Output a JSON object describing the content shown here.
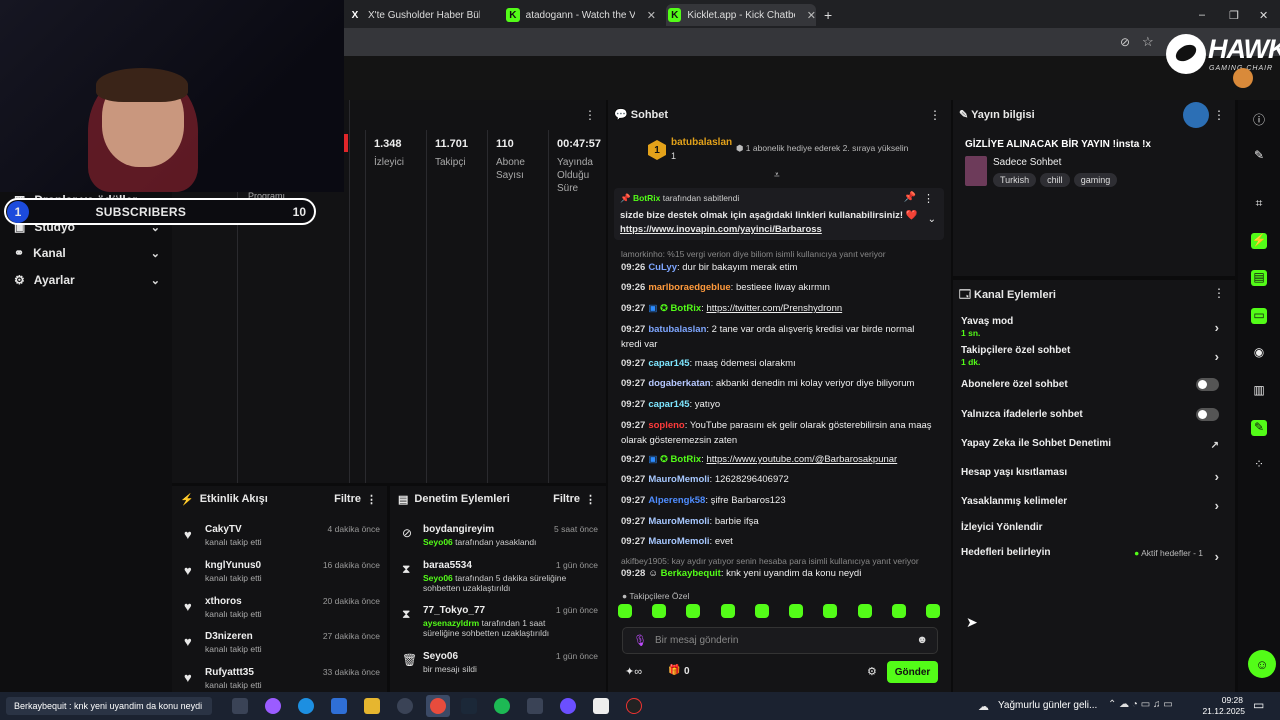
{
  "browser": {
    "tabs": [
      {
        "icon": "X",
        "label": "X'te Gusholder Haber Bülteni: \""
      },
      {
        "icon": "K",
        "label": "atadogann - Watch the VOD on"
      },
      {
        "icon": "K",
        "label": "Kicklet.app - Kick Chatbot and C"
      }
    ],
    "new_tab": "+",
    "window_controls": [
      "–",
      "❐",
      "✕"
    ]
  },
  "overlay": {
    "logo_text": "HAWK",
    "logo_sub": "GAMING CHAIR",
    "subs_current": "1",
    "subs_label": "SUBSCRIBERS",
    "subs_goal": "10"
  },
  "sidebar": {
    "items": [
      {
        "icon": "drops-icon",
        "label": "Droplar ve ödüller"
      },
      {
        "icon": "studio-icon",
        "label": "Stüdyo"
      },
      {
        "icon": "channel-icon",
        "label": "Kanal"
      },
      {
        "icon": "settings-icon",
        "label": "Ayarlar"
      }
    ]
  },
  "stats": {
    "program_label": "Programı",
    "items": [
      {
        "value": "1.348",
        "label": "İzleyici"
      },
      {
        "value": "11.701",
        "label": "Takipçi"
      },
      {
        "value": "110",
        "label": "Abone Sayısı"
      },
      {
        "value": "00:47:57",
        "label": "Yayında Olduğu Süre"
      }
    ]
  },
  "activity_feed": {
    "title": "Etkinlik Akışı",
    "filter": "Filtre",
    "items": [
      {
        "name": "CakyTV",
        "sub": "kanalı takip etti",
        "time": "4 dakika önce"
      },
      {
        "name": "knglYunus0",
        "sub": "kanalı takip etti",
        "time": "16 dakika önce"
      },
      {
        "name": "xthoros",
        "sub": "kanalı takip etti",
        "time": "20 dakika önce"
      },
      {
        "name": "D3nizeren",
        "sub": "kanalı takip etti",
        "time": "27 dakika önce"
      },
      {
        "name": "Rufyattt35",
        "sub": "kanalı takip etti",
        "time": "33 dakika önce"
      }
    ]
  },
  "moderation": {
    "title": "Denetim Eylemleri",
    "filter": "Filtre",
    "items": [
      {
        "icon": "ban-icon",
        "name": "boydangireyim",
        "actor": "Seyo06",
        "sub": " tarafından yasaklandı",
        "time": "5 saat önce"
      },
      {
        "icon": "hourglass-icon",
        "name": "baraa5534",
        "actor": "Seyo06",
        "sub": " tarafından 5 dakika süreliğine sohbetten uzaklaştırıldı",
        "time": "1 gün önce"
      },
      {
        "icon": "hourglass-icon",
        "name": "77_Tokyo_77",
        "actor": "aysenazyldrm",
        "sub": " tarafından 1 saat süreliğine sohbetten uzaklaştırıldı",
        "time": "1 gün önce"
      },
      {
        "icon": "trash-icon",
        "name": "Seyo06",
        "actor": "",
        "sub": "bir mesajı sildi",
        "time": "1 gün önce"
      }
    ]
  },
  "chat": {
    "title": "Sohbet",
    "gifter_name": "batubalaslan",
    "gifter_rank": "1",
    "gifter_count": "1",
    "gift_text": "1 abonelik hediye ederek 2. sıraya yükselin",
    "pinned_by": "BotRix",
    "pinned_suffix": " tarafından sabitlendi",
    "pinned_text": "sizde bize destek olmak için aşağıdaki linkleri kullanabilirsiniz! ❤️",
    "pinned_link": "https://www.inovapin.com/yayinci/Barbaross",
    "reply1": "lamorkinho: %15 vergi verion diye biliom isimli kullanıcıya yanıt veriyor",
    "messages": [
      {
        "time": "09:26",
        "user": "CuLyy",
        "color": "#7ea6ff",
        "text": ": dur bir bakayım merak etim"
      },
      {
        "time": "09:26",
        "user": "marlboraedgeblue",
        "color": "#ff9a3c",
        "text": ": bestieee liway akırmın"
      },
      {
        "time": "09:27",
        "user": "BotRix",
        "color": "#53fc18",
        "text": ": ",
        "link": "https://twitter.com/Prenshydronn"
      },
      {
        "time": "09:27",
        "user": "batubalaslan",
        "color": "#7ea6ff",
        "text": ": 2 tane var orda alışveriş kredisi var birde normal kredi var"
      },
      {
        "time": "09:27",
        "user": "capar145",
        "color": "#7ee6ff",
        "text": ": maaş ödemesi olarakmı"
      },
      {
        "time": "09:27",
        "user": "dogaberkatan",
        "color": "#b6c8ff",
        "text": ": akbanki denedin mi kolay veriyor diye biliyorum"
      },
      {
        "time": "09:27",
        "user": "capar145",
        "color": "#7ee6ff",
        "text": ": yatıyo"
      },
      {
        "time": "09:27",
        "user": "sopleno",
        "color": "#ff3b3b",
        "text": ": YouTube parasını ek gelir olarak gösterebilirsin ana maaş olarak gösteremezsin zaten"
      },
      {
        "time": "09:27",
        "user": "BotRix",
        "color": "#53fc18",
        "text": ": ",
        "link": "https://www.youtube.com/@Barbarosakpunar"
      },
      {
        "time": "09:27",
        "user": "MauroMemoli",
        "color": "#a7c8ff",
        "text": ": 12628296406972"
      },
      {
        "time": "09:27",
        "user": "Alperengk58",
        "color": "#4f8dff",
        "text": ": şifre Barbaros123"
      },
      {
        "time": "09:27",
        "user": "MauroMemoli",
        "color": "#a7c8ff",
        "text": ": barbie ifşa"
      },
      {
        "time": "09:27",
        "user": "MauroMemoli",
        "color": "#a7c8ff",
        "text": ": evet"
      }
    ],
    "reply2": "akifbey1905: kay aydır yatıyor senin hesaba para isimli kullanıcıya yanıt veriyor",
    "last_message": {
      "time": "09:28",
      "user": "Berkaybequit",
      "color": "#53fc18",
      "text": ": knk yeni uyandim da konu neydi"
    },
    "emote_label": "Takipçilere Özel",
    "input_placeholder": "Bir mesaj gönderin",
    "points": "0",
    "send_label": "Gönder"
  },
  "stream_info": {
    "title": "Yayın bilgisi",
    "stream_title": "GİZLİYE ALINACAK BİR YAYIN !insta !x",
    "category": "Sadece Sohbet",
    "tags": [
      "Turkish",
      "chill",
      "gaming"
    ]
  },
  "channel_actions": {
    "title": "Kanal Eylemleri",
    "items": [
      {
        "label": "Yavaş mod",
        "sub": "1 sn.",
        "control": "arrow"
      },
      {
        "label": "Takipçilere özel sohbet",
        "sub": "1 dk.",
        "control": "arrow"
      },
      {
        "label": "Abonelere özel sohbet",
        "sub": "",
        "control": "toggle"
      },
      {
        "label": "Yalnızca ifadelerle sohbet",
        "sub": "",
        "control": "toggle"
      },
      {
        "label": "Yapay Zeka ile Sohbet Denetimi",
        "sub": "",
        "control": "external"
      },
      {
        "label": "Hesap yaşı kısıtlaması",
        "sub": "",
        "control": "arrow"
      },
      {
        "label": "Yasaklanmış kelimeler",
        "sub": "",
        "control": "arrow"
      },
      {
        "label": "İzleyici Yönlendir",
        "sub": "",
        "control": "none"
      },
      {
        "label": "Hedefleri belirleyin",
        "sub": "",
        "control": "arrow",
        "badge": "Aktif hedefler - 1"
      }
    ]
  },
  "taskbar": {
    "notification": "Berkaybequit : knk yeni uyandim da konu neydi",
    "weather": "Yağmurlu günler geli...",
    "time": "09:28",
    "date": "21.12.2025"
  },
  "colors": {
    "accent": "#53fc18",
    "panel": "#141416",
    "background": "#0b0b0c"
  }
}
